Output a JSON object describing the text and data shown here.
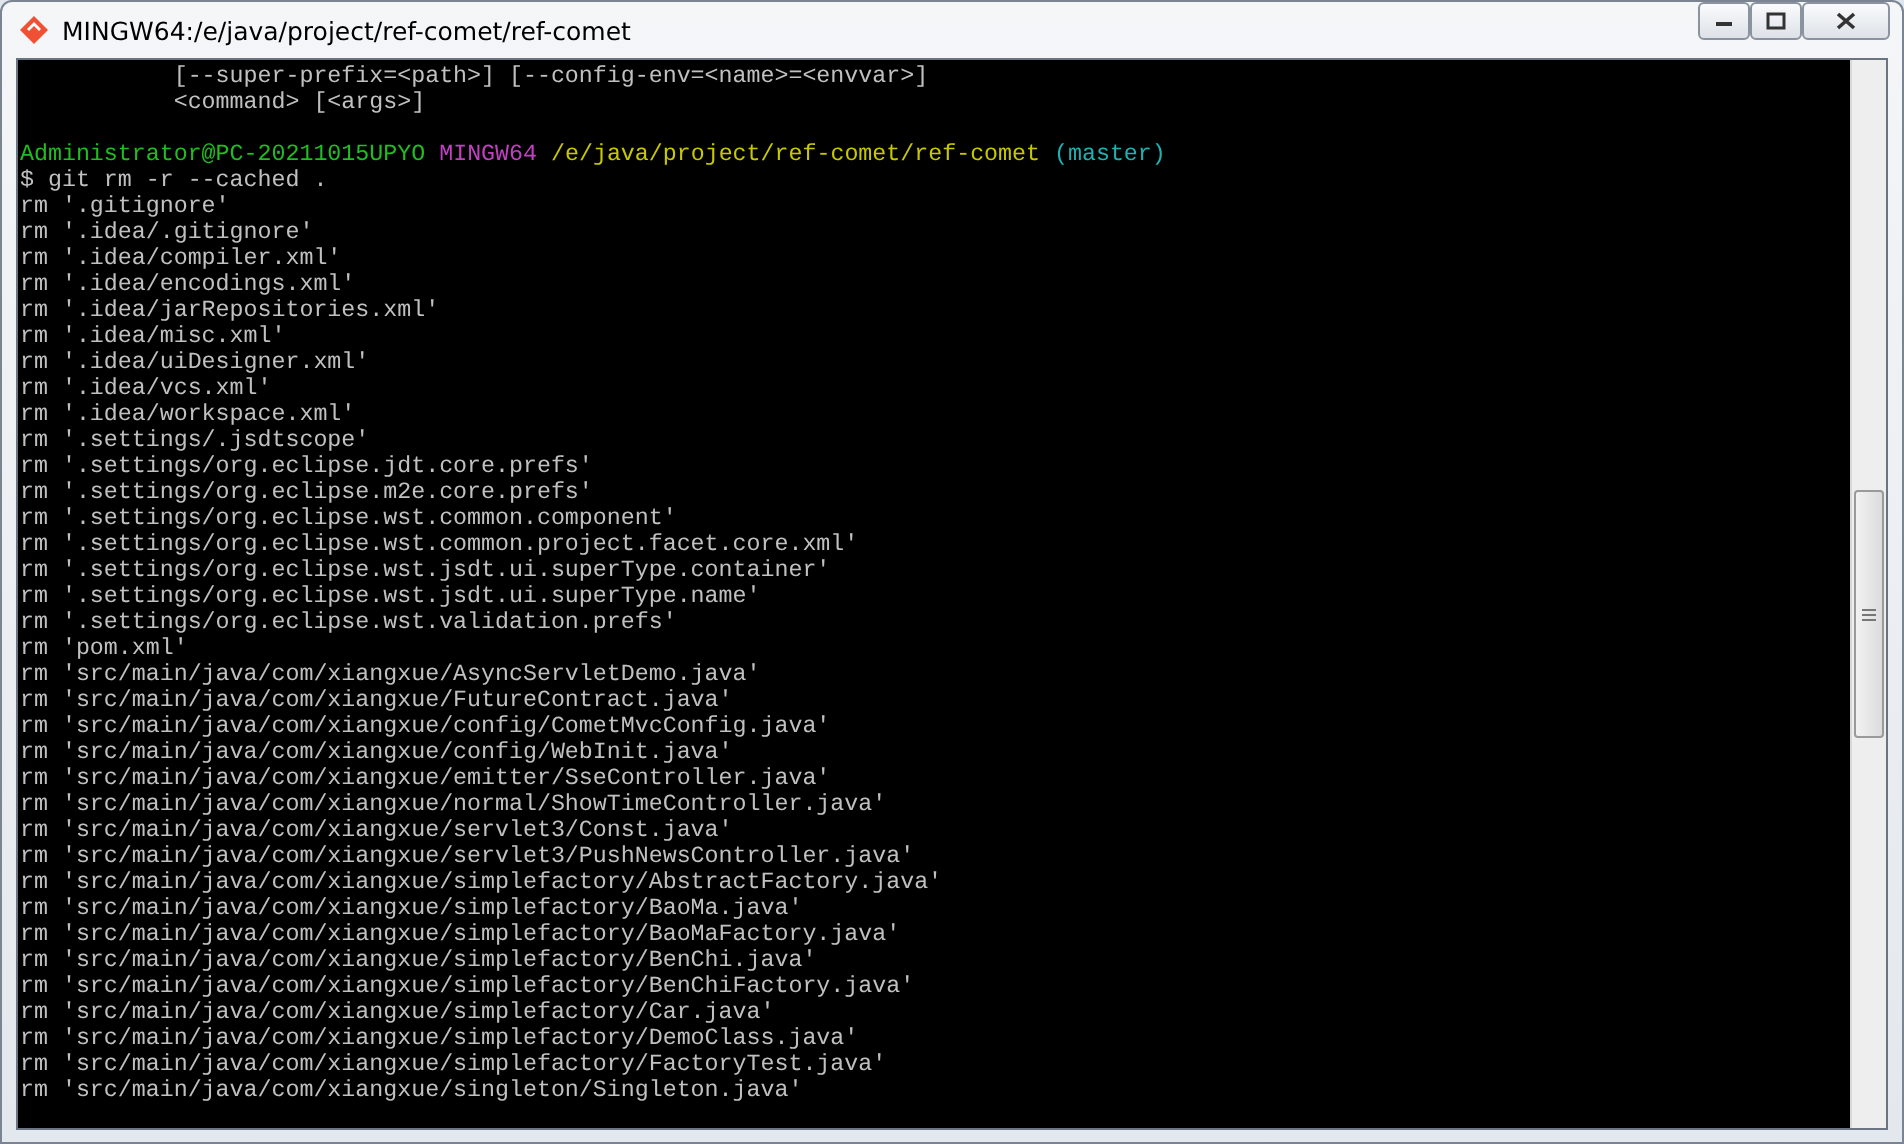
{
  "window": {
    "title": "MINGW64:/e/java/project/ref-comet/ref-comet"
  },
  "terminal": {
    "lines": [
      {
        "kind": "output",
        "text": "           [--super-prefix=<path>] [--config-env=<name>=<envvar>]"
      },
      {
        "kind": "output",
        "text": "           <command> [<args>]"
      },
      {
        "kind": "blank"
      },
      {
        "kind": "prompt",
        "user": "Administrator@PC-20211015UPYO",
        "shell": "MINGW64",
        "path": "/e/java/project/ref-comet/ref-comet",
        "branch": "(master)"
      },
      {
        "kind": "output",
        "text": "$ git rm -r --cached ."
      },
      {
        "kind": "output",
        "text": "rm '.gitignore'"
      },
      {
        "kind": "output",
        "text": "rm '.idea/.gitignore'"
      },
      {
        "kind": "output",
        "text": "rm '.idea/compiler.xml'"
      },
      {
        "kind": "output",
        "text": "rm '.idea/encodings.xml'"
      },
      {
        "kind": "output",
        "text": "rm '.idea/jarRepositories.xml'"
      },
      {
        "kind": "output",
        "text": "rm '.idea/misc.xml'"
      },
      {
        "kind": "output",
        "text": "rm '.idea/uiDesigner.xml'"
      },
      {
        "kind": "output",
        "text": "rm '.idea/vcs.xml'"
      },
      {
        "kind": "output",
        "text": "rm '.idea/workspace.xml'"
      },
      {
        "kind": "output",
        "text": "rm '.settings/.jsdtscope'"
      },
      {
        "kind": "output",
        "text": "rm '.settings/org.eclipse.jdt.core.prefs'"
      },
      {
        "kind": "output",
        "text": "rm '.settings/org.eclipse.m2e.core.prefs'"
      },
      {
        "kind": "output",
        "text": "rm '.settings/org.eclipse.wst.common.component'"
      },
      {
        "kind": "output",
        "text": "rm '.settings/org.eclipse.wst.common.project.facet.core.xml'"
      },
      {
        "kind": "output",
        "text": "rm '.settings/org.eclipse.wst.jsdt.ui.superType.container'"
      },
      {
        "kind": "output",
        "text": "rm '.settings/org.eclipse.wst.jsdt.ui.superType.name'"
      },
      {
        "kind": "output",
        "text": "rm '.settings/org.eclipse.wst.validation.prefs'"
      },
      {
        "kind": "output",
        "text": "rm 'pom.xml'"
      },
      {
        "kind": "output",
        "text": "rm 'src/main/java/com/xiangxue/AsyncServletDemo.java'"
      },
      {
        "kind": "output",
        "text": "rm 'src/main/java/com/xiangxue/FutureContract.java'"
      },
      {
        "kind": "output",
        "text": "rm 'src/main/java/com/xiangxue/config/CometMvcConfig.java'"
      },
      {
        "kind": "output",
        "text": "rm 'src/main/java/com/xiangxue/config/WebInit.java'"
      },
      {
        "kind": "output",
        "text": "rm 'src/main/java/com/xiangxue/emitter/SseController.java'"
      },
      {
        "kind": "output",
        "text": "rm 'src/main/java/com/xiangxue/normal/ShowTimeController.java'"
      },
      {
        "kind": "output",
        "text": "rm 'src/main/java/com/xiangxue/servlet3/Const.java'"
      },
      {
        "kind": "output",
        "text": "rm 'src/main/java/com/xiangxue/servlet3/PushNewsController.java'"
      },
      {
        "kind": "output",
        "text": "rm 'src/main/java/com/xiangxue/simplefactory/AbstractFactory.java'"
      },
      {
        "kind": "output",
        "text": "rm 'src/main/java/com/xiangxue/simplefactory/BaoMa.java'"
      },
      {
        "kind": "output",
        "text": "rm 'src/main/java/com/xiangxue/simplefactory/BaoMaFactory.java'"
      },
      {
        "kind": "output",
        "text": "rm 'src/main/java/com/xiangxue/simplefactory/BenChi.java'"
      },
      {
        "kind": "output",
        "text": "rm 'src/main/java/com/xiangxue/simplefactory/BenChiFactory.java'"
      },
      {
        "kind": "output",
        "text": "rm 'src/main/java/com/xiangxue/simplefactory/Car.java'"
      },
      {
        "kind": "output",
        "text": "rm 'src/main/java/com/xiangxue/simplefactory/DemoClass.java'"
      },
      {
        "kind": "output",
        "text": "rm 'src/main/java/com/xiangxue/simplefactory/FactoryTest.java'"
      },
      {
        "kind": "output",
        "text": "rm 'src/main/java/com/xiangxue/singleton/Singleton.java'"
      }
    ]
  }
}
